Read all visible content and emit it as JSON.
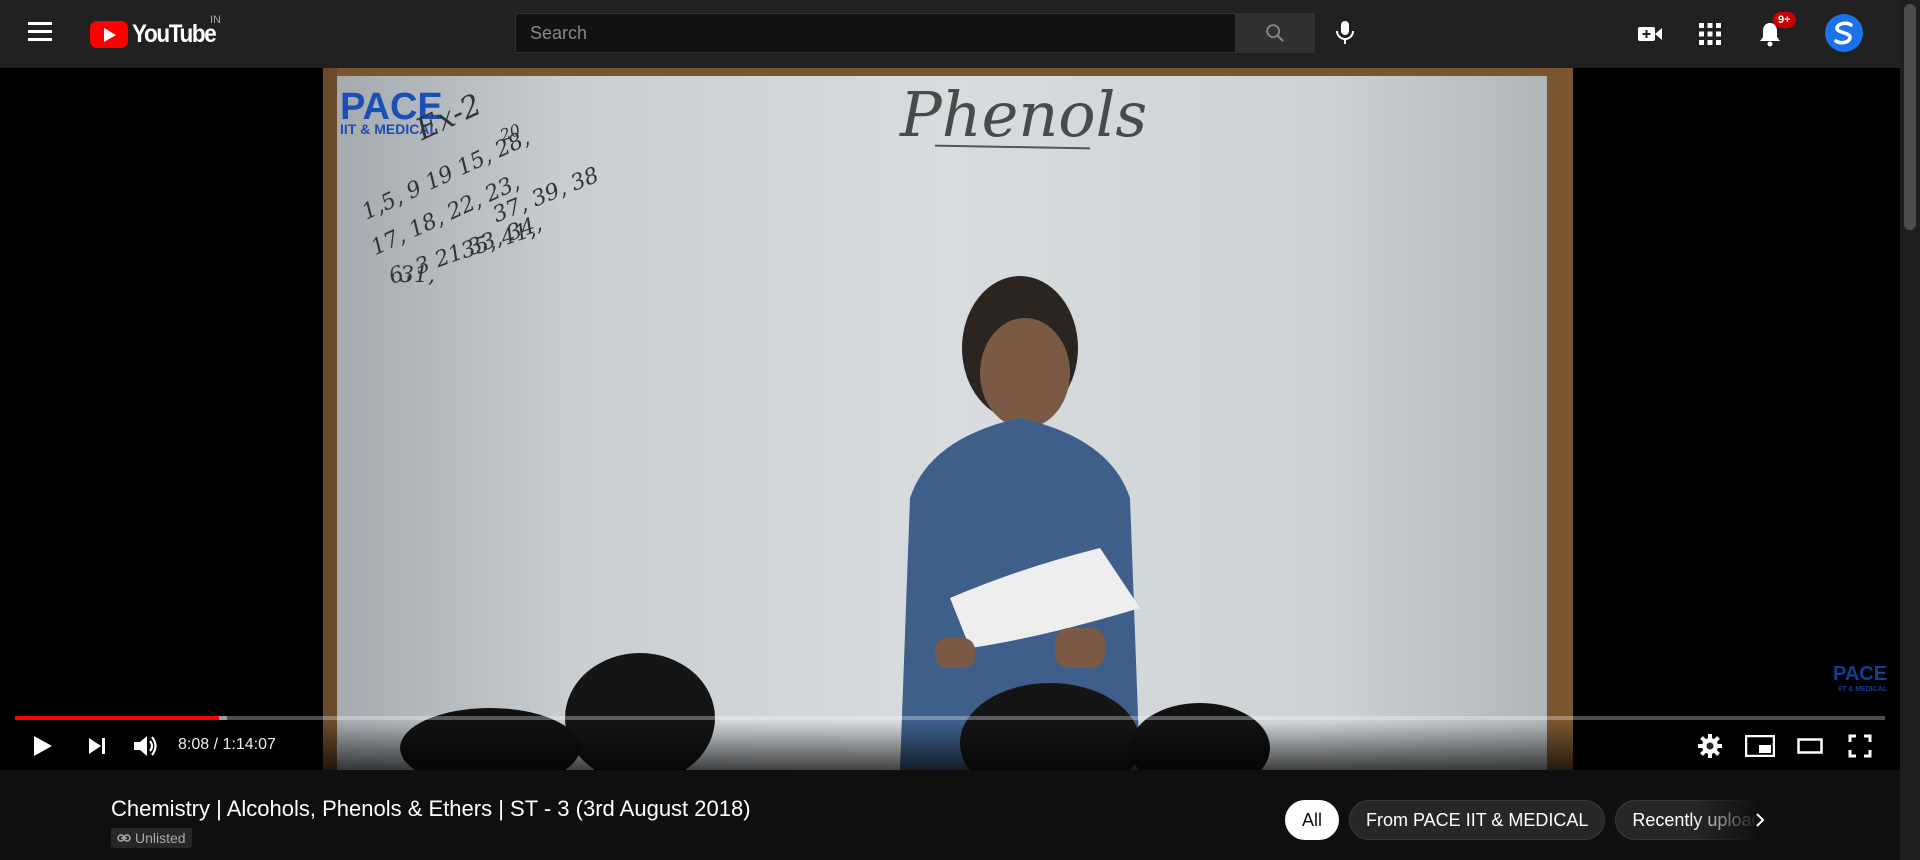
{
  "masthead": {
    "logo_text": "YouTube",
    "country_code": "IN",
    "search_placeholder": "Search",
    "notification_count": "9+"
  },
  "video_content": {
    "board_logo": "PACE",
    "board_logo_sub": "IIT & MEDICAL",
    "board_heading": "Phenols",
    "scribbles": [
      "Ex-2",
      "20",
      "1,5, 9 19 15, 28,",
      "17, 18, 22, 23,",
      "37, 39, 38",
      "6, 3 21 33, 34,",
      "35, 41,",
      "31,"
    ],
    "watermark": "PACE",
    "watermark_sub": "IIT & MEDICAL"
  },
  "player": {
    "current_time": "8:08",
    "separator": " / ",
    "duration": "1:14:07",
    "played_fraction": 0.1093,
    "loaded_fraction": 0.1135
  },
  "video": {
    "title": "Chemistry | Alcohols, Phenols & Ethers | ST - 3 (3rd August 2018)",
    "visibility": "Unlisted"
  },
  "chips": [
    {
      "label": "All",
      "active": true
    },
    {
      "label": "From PACE IIT & MEDICAL",
      "active": false
    },
    {
      "label": "Recently uploaded",
      "active": false
    }
  ],
  "colors": {
    "accent": "#ff0000",
    "masthead_bg": "#212121",
    "page_bg": "#0f0f0f",
    "badge": "#cc0000"
  },
  "icons": [
    "menu-icon",
    "youtube-logo-icon",
    "search-icon",
    "mic-icon",
    "create-video-icon",
    "apps-grid-icon",
    "bell-icon",
    "avatar",
    "play-icon",
    "next-icon",
    "volume-icon",
    "settings-icon",
    "miniplayer-icon",
    "theater-icon",
    "fullscreen-icon",
    "link-icon",
    "chevron-right-icon"
  ]
}
